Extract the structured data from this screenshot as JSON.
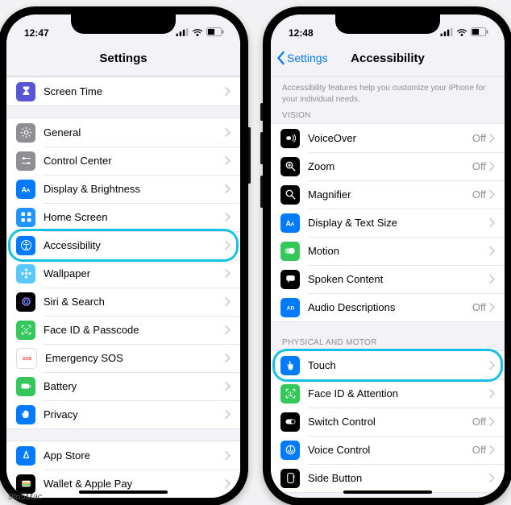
{
  "credit": "9to5Mac",
  "left": {
    "time": "12:47",
    "title": "Settings",
    "highlight_index": 4,
    "groups": [
      {
        "rows": [
          {
            "icon": "hourglass-icon",
            "bg": "c-purple",
            "label": "Screen Time"
          }
        ]
      },
      {
        "rows": [
          {
            "icon": "gear-icon",
            "bg": "c-gray",
            "label": "General"
          },
          {
            "icon": "sliders-icon",
            "bg": "c-gray",
            "label": "Control Center"
          },
          {
            "icon": "text-size-icon",
            "bg": "c-blue",
            "label": "Display & Brightness"
          },
          {
            "icon": "grid-icon",
            "bg": "c-lblue",
            "label": "Home Screen"
          },
          {
            "icon": "accessibility-icon",
            "bg": "c-blue",
            "label": "Accessibility"
          },
          {
            "icon": "flower-icon",
            "bg": "c-cyan",
            "label": "Wallpaper"
          },
          {
            "icon": "siri-icon",
            "bg": "c-black",
            "label": "Siri & Search"
          },
          {
            "icon": "faceid-icon",
            "bg": "c-green",
            "label": "Face ID & Passcode"
          },
          {
            "icon": "sos-icon",
            "bg": "c-sos",
            "label": "Emergency SOS"
          },
          {
            "icon": "battery-icon",
            "bg": "c-green",
            "label": "Battery"
          },
          {
            "icon": "hand-icon",
            "bg": "c-blue",
            "label": "Privacy"
          }
        ]
      },
      {
        "rows": [
          {
            "icon": "appstore-icon",
            "bg": "c-blue",
            "label": "App Store"
          },
          {
            "icon": "wallet-icon",
            "bg": "c-black",
            "label": "Wallet & Apple Pay"
          }
        ]
      }
    ]
  },
  "right": {
    "time": "12:48",
    "back": "Settings",
    "title": "Accessibility",
    "desc": "Accessibility features help you customize your iPhone for your individual needs.",
    "highlight_group": 1,
    "highlight_index": 0,
    "groups": [
      {
        "header": "VISION",
        "rows": [
          {
            "icon": "voiceover-icon",
            "bg": "c-black",
            "label": "VoiceOver",
            "value": "Off"
          },
          {
            "icon": "zoom-icon",
            "bg": "c-black",
            "label": "Zoom",
            "value": "Off"
          },
          {
            "icon": "magnifier-icon",
            "bg": "c-black",
            "label": "Magnifier",
            "value": "Off"
          },
          {
            "icon": "text-size-icon",
            "bg": "c-blue",
            "label": "Display & Text Size"
          },
          {
            "icon": "motion-icon",
            "bg": "c-green",
            "label": "Motion"
          },
          {
            "icon": "speech-icon",
            "bg": "c-black",
            "label": "Spoken Content"
          },
          {
            "icon": "audio-desc-icon",
            "bg": "c-blue",
            "label": "Audio Descriptions",
            "value": "Off"
          }
        ]
      },
      {
        "header": "PHYSICAL AND MOTOR",
        "rows": [
          {
            "icon": "touch-icon",
            "bg": "c-blue",
            "label": "Touch"
          },
          {
            "icon": "faceid-icon",
            "bg": "c-green",
            "label": "Face ID & Attention"
          },
          {
            "icon": "switch-icon",
            "bg": "c-black",
            "label": "Switch Control",
            "value": "Off"
          },
          {
            "icon": "voice-ctrl-icon",
            "bg": "c-blue",
            "label": "Voice Control",
            "value": "Off"
          },
          {
            "icon": "side-button-icon",
            "bg": "c-black",
            "label": "Side Button"
          }
        ]
      }
    ]
  }
}
